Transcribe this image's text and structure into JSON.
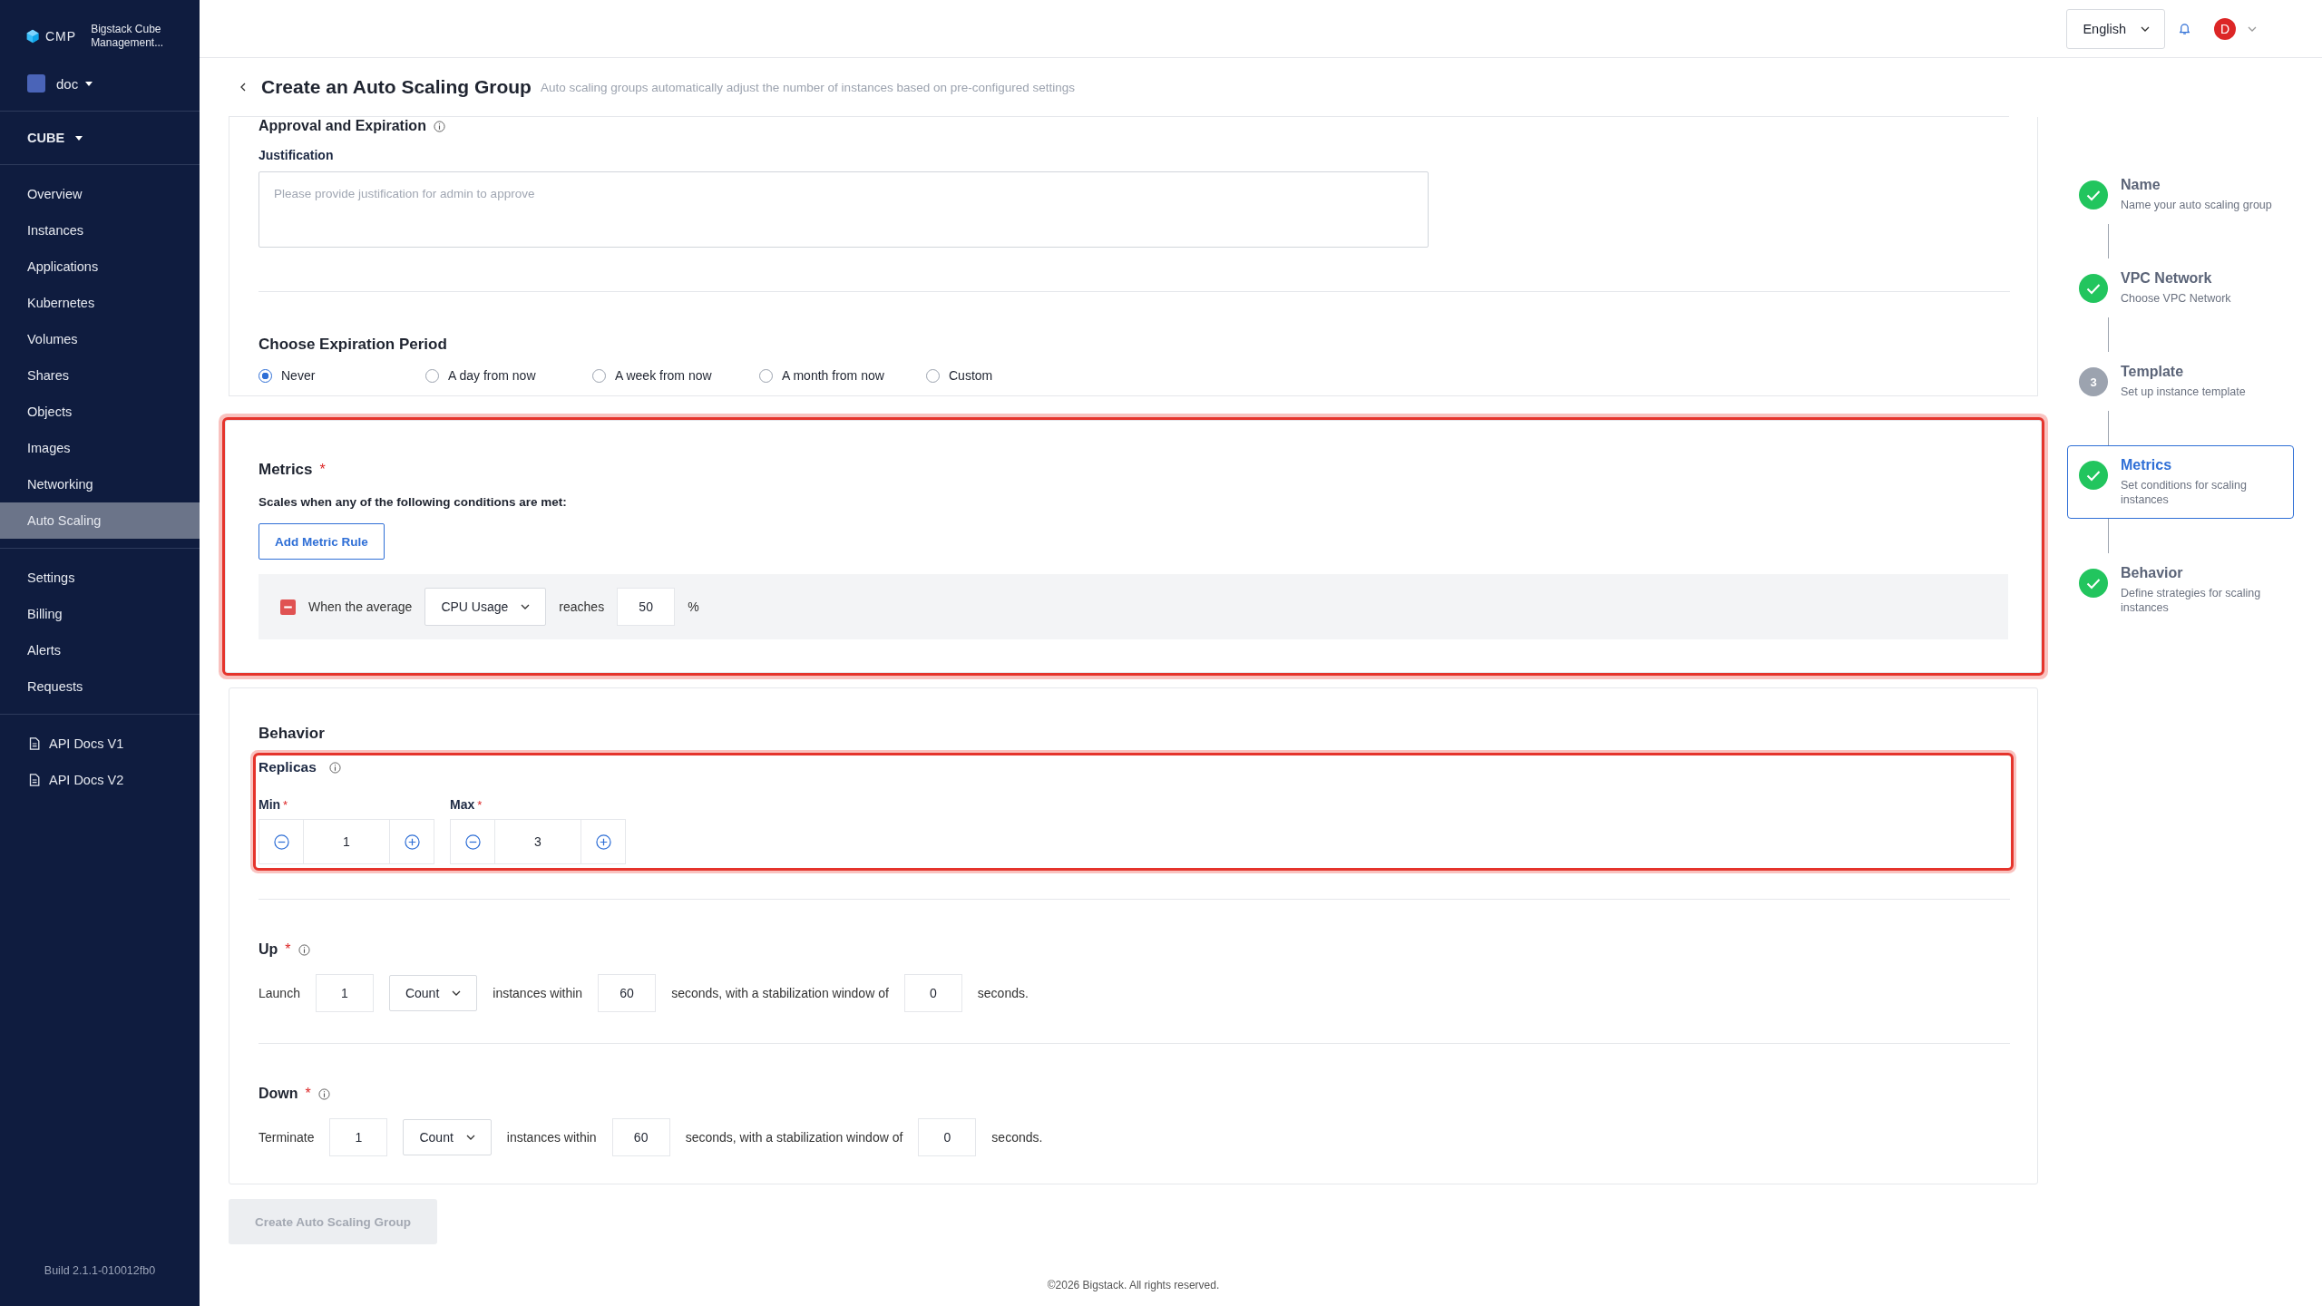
{
  "sidebar": {
    "brand": "CMP",
    "product": "Bigstack Cube Management...",
    "project": {
      "name": "doc",
      "color": "#4a64b8"
    },
    "region": "CUBE",
    "items": [
      {
        "label": "Overview",
        "selected": false
      },
      {
        "label": "Instances",
        "selected": false
      },
      {
        "label": "Applications",
        "selected": false
      },
      {
        "label": "Kubernetes",
        "selected": false
      },
      {
        "label": "Volumes",
        "selected": false
      },
      {
        "label": "Shares",
        "selected": false
      },
      {
        "label": "Objects",
        "selected": false
      },
      {
        "label": "Images",
        "selected": false
      },
      {
        "label": "Networking",
        "selected": false
      },
      {
        "label": "Auto Scaling",
        "selected": true
      }
    ],
    "items2": [
      {
        "label": "Settings",
        "selected": false
      },
      {
        "label": "Billing",
        "selected": false
      },
      {
        "label": "Alerts",
        "selected": false
      },
      {
        "label": "Requests",
        "selected": false
      }
    ],
    "docs": [
      "API Docs V1",
      "API Docs V2"
    ],
    "build": "Build 2.1.1-010012fb0"
  },
  "header": {
    "language": "English",
    "avatar": "D"
  },
  "page": {
    "title": "Create an Auto Scaling Group",
    "subtitle": "Auto scaling groups automatically adjust the number of instances based on pre-configured settings"
  },
  "approval": {
    "heading": "Approval and Expiration",
    "justification_label": "Justification",
    "placeholder": "Please provide justification for admin to approve",
    "expiration_heading": "Choose Expiration Period",
    "options": [
      {
        "label": "Never",
        "selected": true
      },
      {
        "label": "A day from now",
        "selected": false
      },
      {
        "label": "A week from now",
        "selected": false
      },
      {
        "label": "A month from now",
        "selected": false
      },
      {
        "label": "Custom",
        "selected": false
      }
    ]
  },
  "metrics": {
    "heading": "Metrics",
    "mark": "*",
    "description": "Scales when any of the following conditions are met:",
    "add_button": "Add Metric Rule",
    "rules": [
      {
        "prefix": "When the average",
        "metric": "CPU Usage",
        "verb": "reaches",
        "value": "50",
        "unit": "%"
      }
    ]
  },
  "behavior": {
    "heading": "Behavior",
    "replicas_label": "Replicas",
    "replicas": [
      {
        "label": "Min",
        "mark": "*",
        "value": "1"
      },
      {
        "label": "Max",
        "mark": "*",
        "value": "3"
      }
    ],
    "policies": [
      {
        "label": "Up",
        "mark": "*",
        "parts": [
          {
            "kind": "text",
            "text": "Launch"
          },
          {
            "kind": "input",
            "text": "1"
          },
          {
            "kind": "select",
            "text": "Count"
          },
          {
            "kind": "text",
            "text": "instances within"
          },
          {
            "kind": "input",
            "text": "60"
          },
          {
            "kind": "text",
            "text": "seconds, with a stabilization window of"
          },
          {
            "kind": "input",
            "text": "0"
          },
          {
            "kind": "text",
            "text": "seconds."
          }
        ]
      },
      {
        "label": "Down",
        "mark": "*",
        "parts": [
          {
            "kind": "text",
            "text": "Terminate"
          },
          {
            "kind": "input",
            "text": "1"
          },
          {
            "kind": "select",
            "text": "Count"
          },
          {
            "kind": "text",
            "text": "instances within"
          },
          {
            "kind": "input",
            "text": "60"
          },
          {
            "kind": "text",
            "text": "seconds, with a stabilization window of"
          },
          {
            "kind": "input",
            "text": "0"
          },
          {
            "kind": "text",
            "text": "seconds."
          }
        ]
      }
    ]
  },
  "submit": {
    "label": "Create Auto Scaling Group",
    "disabled": true
  },
  "steps": [
    {
      "title": "Name",
      "subtitle": "Name your auto scaling group",
      "kind": "done",
      "selected": false
    },
    {
      "title": "VPC Network",
      "subtitle": "Choose VPC Network",
      "kind": "done",
      "selected": false
    },
    {
      "title": "Template",
      "subtitle": "Set up instance template",
      "kind": "pending",
      "number": "3",
      "selected": false
    },
    {
      "title": "Metrics",
      "subtitle": "Set conditions for scaling instances",
      "kind": "done",
      "selected": true
    },
    {
      "title": "Behavior",
      "subtitle": "Define strategies for scaling instances",
      "kind": "done",
      "selected": false
    }
  ],
  "footer": "©2026 Bigstack. All rights reserved."
}
